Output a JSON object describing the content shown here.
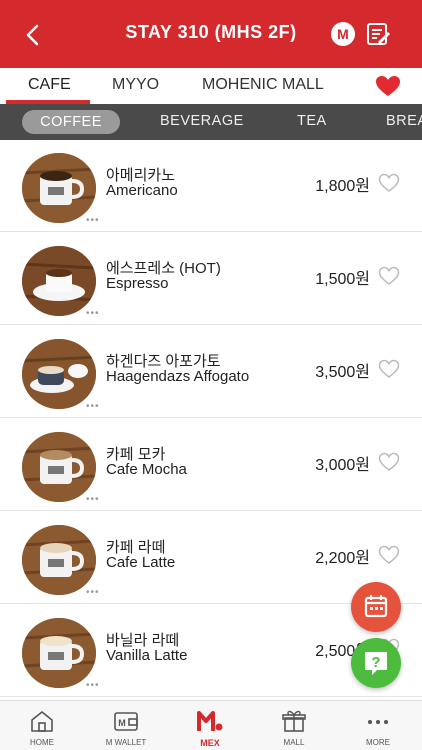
{
  "header": {
    "title": "STAY 310 (MHS 2F)",
    "m_badge": "M",
    "accent_color": "#d42a2e"
  },
  "store_tabs": [
    {
      "label": "CAFE",
      "active": true
    },
    {
      "label": "MYYO",
      "active": false
    },
    {
      "label": "MOHENIC MALL",
      "active": false
    }
  ],
  "categories": [
    {
      "label": "COFFEE",
      "active": true
    },
    {
      "label": "BEVERAGE",
      "active": false
    },
    {
      "label": "TEA",
      "active": false
    },
    {
      "label": "BREA",
      "active": false
    }
  ],
  "items": [
    {
      "name_ko": "아메리카노",
      "name_en": "Americano",
      "price": "1,800원",
      "more": "•••"
    },
    {
      "name_ko": "에스프레소 (HOT)",
      "name_en": "Espresso",
      "price": "1,500원",
      "more": "•••"
    },
    {
      "name_ko": "하겐다즈 아포가토",
      "name_en": "Haagendazs Affogato",
      "price": "3,500원",
      "more": "•••"
    },
    {
      "name_ko": "카페 모카",
      "name_en": "Cafe Mocha",
      "price": "3,000원",
      "more": "•••"
    },
    {
      "name_ko": "카페 라떼",
      "name_en": "Cafe Latte",
      "price": "2,200원",
      "more": "•••"
    },
    {
      "name_ko": "바닐라 라떼",
      "name_en": "Vanilla Latte",
      "price": "2,500원",
      "more": "•••"
    }
  ],
  "fabs": {
    "calendar_icon": "calendar-icon",
    "help_icon": "help-icon",
    "calendar_color": "#e5533d",
    "help_color": "#4cbb3e"
  },
  "bottom_nav": [
    {
      "label": "HOME",
      "icon": "home-icon",
      "active": false
    },
    {
      "label": "M WALLET",
      "icon": "wallet-icon",
      "active": false
    },
    {
      "label": "MEX",
      "icon": "mex-logo-icon",
      "active": true
    },
    {
      "label": "MALL",
      "icon": "gift-icon",
      "active": false
    },
    {
      "label": "MORE",
      "icon": "more-icon",
      "active": false
    }
  ]
}
